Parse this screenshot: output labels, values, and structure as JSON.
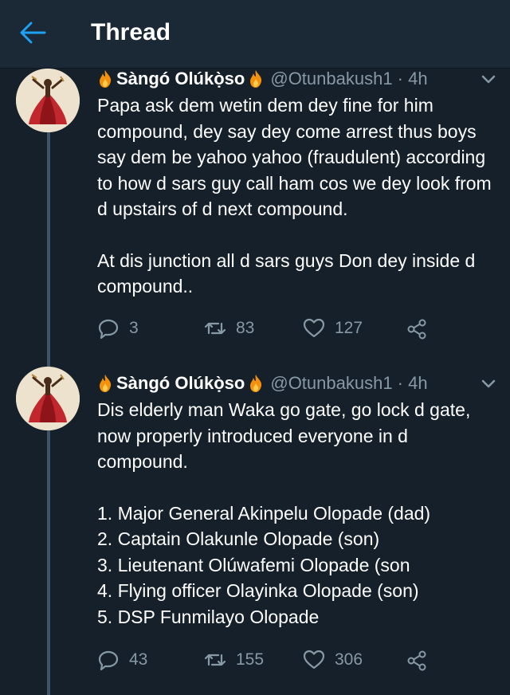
{
  "header": {
    "title": "Thread"
  },
  "tweets": [
    {
      "author": "Sàngó Olúkọ̀so",
      "handle": "@Otunbakush1 · 4h",
      "paragraphs": [
        "Papa ask dem wetin dem dey fine for him compound, dey say dey come arrest thus boys say dem be yahoo yahoo (fraudulent) according to how d sars guy call ham cos we dey look from d upstairs of d next compound.",
        "At dis junction all d sars guys Don dey inside d compound.."
      ],
      "replies": "3",
      "retweets": "83",
      "likes": "127"
    },
    {
      "author": "Sàngó Olúkọ̀so",
      "handle": "@Otunbakush1 · 4h",
      "paragraphs": [
        "Dis elderly man Waka go gate, go lock d gate, now properly introduced everyone in d compound."
      ],
      "list": [
        "1. Major General Akinpelu Olopade (dad)",
        "2. Captain Olakunle Olopade (son)",
        "3. Lieutenant Olúwafemi Olopade (son",
        "4. Flying officer Olayinka Olopade (son)",
        "5. DSP Funmilayo Olopade"
      ],
      "replies": "43",
      "retweets": "155",
      "likes": "306"
    }
  ],
  "icons": {
    "back": "arrow-left-icon",
    "fire": "fire-emoji-icon",
    "reply": "reply-icon",
    "retweet": "retweet-icon",
    "like": "heart-icon",
    "share": "share-icon",
    "more": "chevron-down-icon"
  },
  "colors": {
    "background": "#15202b",
    "header": "#1b2836",
    "accent": "#1da1f2",
    "secondary_text": "#8899a6",
    "thread_line": "#3d5466"
  }
}
